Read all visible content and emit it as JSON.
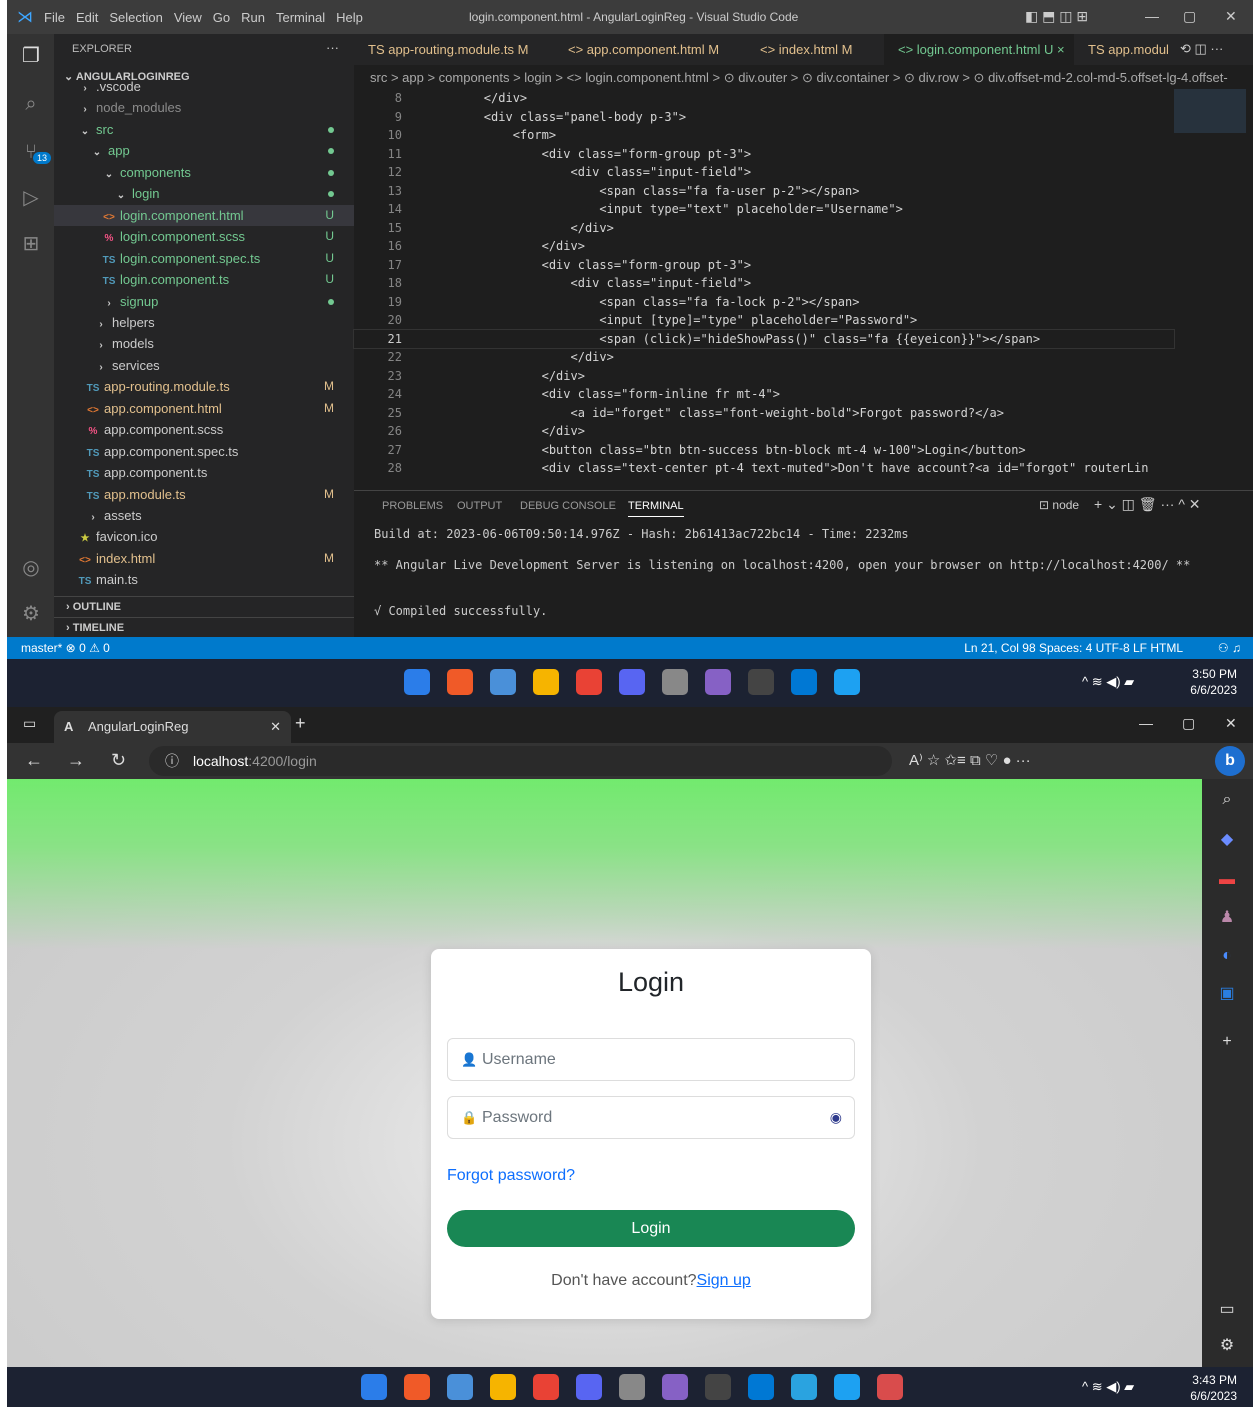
{
  "vscode": {
    "menu": [
      "File",
      "Edit",
      "Selection",
      "View",
      "Go",
      "Run",
      "Terminal",
      "Help"
    ],
    "window_title": "login.component.html - AngularLoginReg - Visual Studio Code",
    "explorer_label": "EXPLORER",
    "explorer_more": "···",
    "project": "ANGULARLOGINREG",
    "scm_badge": "13",
    "tree": [
      {
        "label": ".vscode",
        "icon": ">",
        "color": "#ccc",
        "mark": ""
      },
      {
        "label": "node_modules",
        "icon": ">",
        "color": "#8b8b8b",
        "mark": ""
      },
      {
        "label": "src",
        "icon": "v",
        "color": "#73c991",
        "mark": "dot"
      },
      {
        "label": "app",
        "icon": "v",
        "color": "#73c991",
        "mark": "dot"
      },
      {
        "label": "components",
        "icon": "v",
        "color": "#73c991",
        "mark": "dot"
      },
      {
        "label": "login",
        "icon": "v",
        "color": "#73c991",
        "mark": "dot"
      },
      {
        "label": "login.component.html",
        "icon": "<>",
        "color": "#73c991",
        "mark": "U"
      },
      {
        "label": "login.component.scss",
        "icon": "%",
        "color": "#73c991",
        "mark": "U"
      },
      {
        "label": "login.component.spec.ts",
        "icon": "TS",
        "color": "#73c991",
        "mark": "U"
      },
      {
        "label": "login.component.ts",
        "icon": "TS",
        "color": "#73c991",
        "mark": "U"
      },
      {
        "label": "signup",
        "icon": ">",
        "color": "#73c991",
        "mark": "dot"
      },
      {
        "label": "helpers",
        "icon": ">",
        "color": "#ccc",
        "mark": ""
      },
      {
        "label": "models",
        "icon": ">",
        "color": "#ccc",
        "mark": ""
      },
      {
        "label": "services",
        "icon": ">",
        "color": "#ccc",
        "mark": ""
      },
      {
        "label": "app-routing.module.ts",
        "icon": "TS",
        "color": "#e2c08d",
        "mark": "M"
      },
      {
        "label": "app.component.html",
        "icon": "<>",
        "color": "#e2c08d",
        "mark": "M"
      },
      {
        "label": "app.component.scss",
        "icon": "%",
        "color": "#ccc",
        "mark": ""
      },
      {
        "label": "app.component.spec.ts",
        "icon": "TS",
        "color": "#ccc",
        "mark": ""
      },
      {
        "label": "app.component.ts",
        "icon": "TS",
        "color": "#ccc",
        "mark": ""
      },
      {
        "label": "app.module.ts",
        "icon": "TS",
        "color": "#e2c08d",
        "mark": "M"
      },
      {
        "label": "assets",
        "icon": ">",
        "color": "#ccc",
        "mark": ""
      },
      {
        "label": "favicon.ico",
        "icon": "★",
        "color": "#ccc",
        "mark": ""
      },
      {
        "label": "index.html",
        "icon": "<>",
        "color": "#e2c08d",
        "mark": "M"
      },
      {
        "label": "main.ts",
        "icon": "TS",
        "color": "#ccc",
        "mark": ""
      }
    ],
    "outline": "OUTLINE",
    "timeline": "TIMELINE",
    "tabs": [
      {
        "label": "TS app-routing.module.ts M"
      },
      {
        "label": "<> app.component.html M"
      },
      {
        "label": "<> index.html M"
      },
      {
        "label": "<> login.component.html U ×"
      },
      {
        "label": "TS app.modul"
      }
    ],
    "breadcrumb": "src > app > components > login > <> login.component.html > ⊙ div.outer > ⊙ div.container > ⊙ div.row > ⊙ div.offset-md-2.col-md-5.offset-lg-4.offset-",
    "code": [
      {
        "n": "8",
        "text": "        </div>"
      },
      {
        "n": "9",
        "text": "        <div class=\"panel-body p-3\">"
      },
      {
        "n": "10",
        "text": "            <form>"
      },
      {
        "n": "11",
        "text": "                <div class=\"form-group pt-3\">"
      },
      {
        "n": "12",
        "text": "                    <div class=\"input-field\">"
      },
      {
        "n": "13",
        "text": "                        <span class=\"fa fa-user p-2\"></span>"
      },
      {
        "n": "14",
        "text": "                        <input type=\"text\" placeholder=\"Username\">"
      },
      {
        "n": "15",
        "text": "                    </div>"
      },
      {
        "n": "16",
        "text": "                </div>"
      },
      {
        "n": "17",
        "text": "                <div class=\"form-group pt-3\">"
      },
      {
        "n": "18",
        "text": "                    <div class=\"input-field\">"
      },
      {
        "n": "19",
        "text": "                        <span class=\"fa fa-lock p-2\"></span>"
      },
      {
        "n": "20",
        "text": "                        <input [type]=\"type\" placeholder=\"Password\">"
      },
      {
        "n": "21",
        "text": "                        <span (click)=\"hideShowPass()\" class=\"fa {{eyeicon}}\"></span>"
      },
      {
        "n": "22",
        "text": "                    </div>"
      },
      {
        "n": "23",
        "text": "                </div>"
      },
      {
        "n": "24",
        "text": "                <div class=\"form-inline fr mt-4\">"
      },
      {
        "n": "25",
        "text": "                    <a id=\"forget\" class=\"font-weight-bold\">Forgot password?</a>"
      },
      {
        "n": "26",
        "text": "                </div>"
      },
      {
        "n": "27",
        "text": "                <button class=\"btn btn-success btn-block mt-4 w-100\">Login</button>"
      },
      {
        "n": "28",
        "text": "                <div class=\"text-center pt-4 text-muted\">Don't have account?<a id=\"forgot\" routerLin"
      }
    ],
    "panel_tabs": [
      "PROBLEMS",
      "OUTPUT",
      "DEBUG CONSOLE",
      "TERMINAL"
    ],
    "terminal_name": "node",
    "terminal": [
      "Build at: 2023-06-06T09:50:14.976Z - Hash: 2b61413ac722bc14 - Time: 2232ms",
      "** Angular Live Development Server is listening on localhost:4200, open your browser on http://localhost:4200/ **",
      "√ Compiled successfully."
    ],
    "status_left": "master*   ⊗ 0 ⚠ 0",
    "status_right": "Ln 21, Col 98   Spaces: 4   UTF-8   LF   HTML",
    "clock_time": "3:50 PM",
    "clock_date": "6/6/2023"
  },
  "browser": {
    "tab_title": "AngularLoginReg",
    "address_host": "localhost",
    "address_path": ":4200/login",
    "clock_time": "3:43 PM",
    "clock_date": "6/6/2023"
  },
  "login_card": {
    "title": "Login",
    "username_placeholder": "Username",
    "password_placeholder": "Password",
    "forgot": "Forgot password?",
    "button": "Login",
    "signup_text": "Don't have account?",
    "signup_link": "Sign up"
  },
  "colors": {
    "accent": "#007acc",
    "success": "#198754",
    "link": "#0d6efd",
    "page_top": "#72ea6e"
  }
}
